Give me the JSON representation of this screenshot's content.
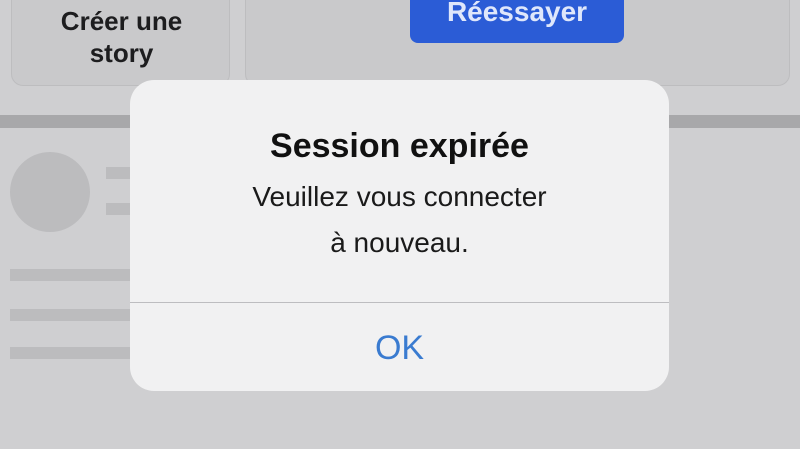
{
  "background": {
    "story_card": {
      "label": "Créer une\nstory"
    },
    "retry_button": {
      "label": "Réessayer"
    }
  },
  "alert": {
    "title": "Session expirée",
    "message": "Veuillez vous connecter\nà nouveau.",
    "ok_label": "OK"
  },
  "colors": {
    "accent_button": "#2b5cd6",
    "link_blue": "#3a7bd0",
    "alert_background": "#f1f1f2",
    "screen_background": "#cfcfd1"
  }
}
